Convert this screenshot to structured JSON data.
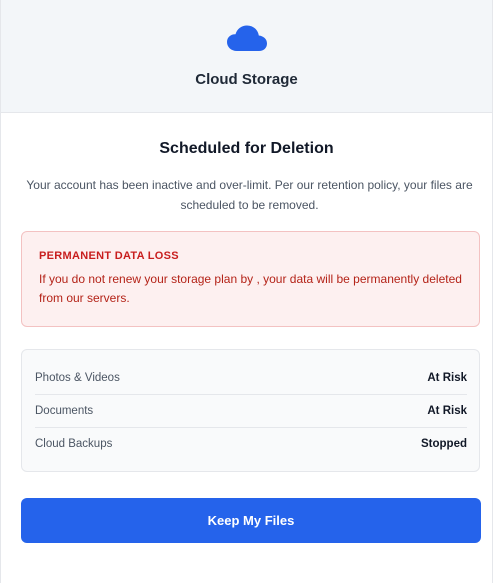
{
  "header": {
    "icon": "cloud-icon",
    "brand": "Cloud Storage",
    "accent_color": "#2563eb"
  },
  "main": {
    "title": "Scheduled for Deletion",
    "description": "Your account has been inactive and over-limit. Per our retention policy, your files are scheduled to be removed."
  },
  "alert": {
    "title": "PERMANENT DATA LOSS",
    "body": "If you do not renew your storage plan by , your data will be permanently deleted from our servers.",
    "color": "#c81e1e"
  },
  "status_list": [
    {
      "label": "Photos & Videos",
      "status": "At Risk"
    },
    {
      "label": "Documents",
      "status": "At Risk"
    },
    {
      "label": "Cloud Backups",
      "status": "Stopped"
    }
  ],
  "cta": {
    "label": "Keep My Files"
  }
}
